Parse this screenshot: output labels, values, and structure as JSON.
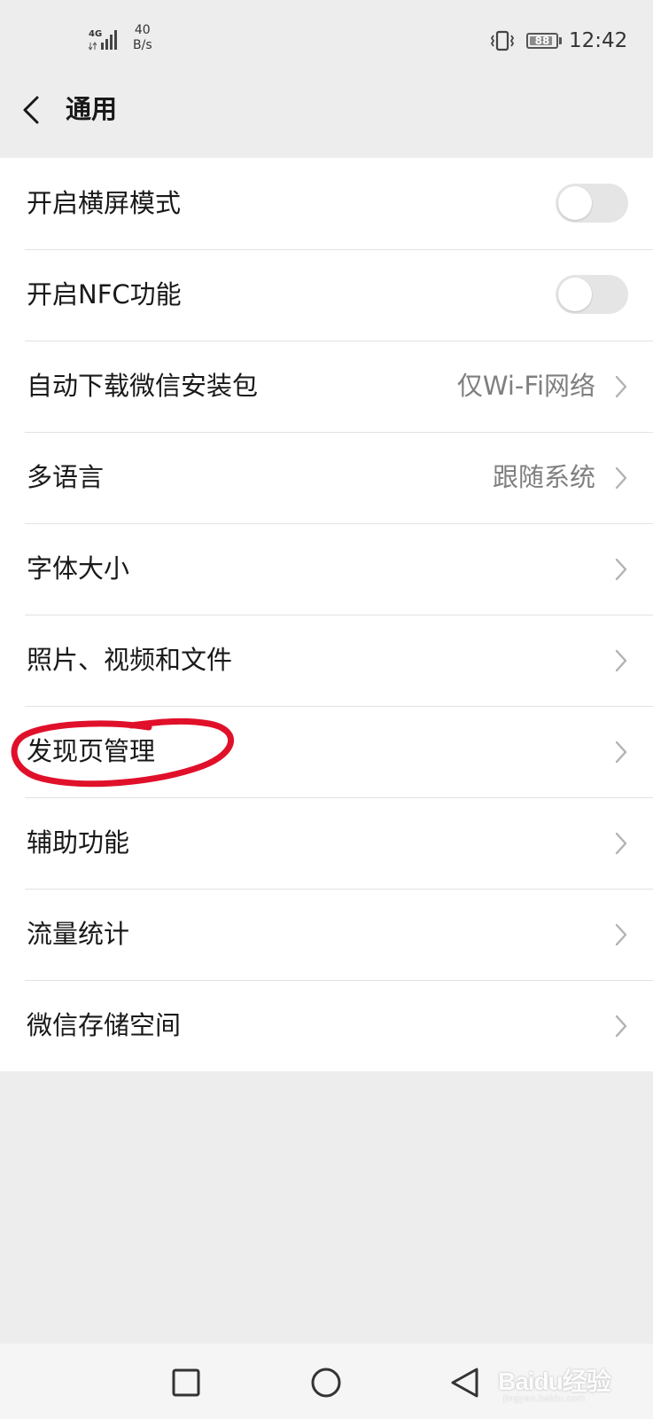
{
  "status_bar": {
    "network_type": "4G",
    "net_speed_value": "40",
    "net_speed_unit": "B/s",
    "battery_level": 88,
    "battery_text": "88",
    "time": "12:42"
  },
  "header": {
    "title": "通用",
    "back_icon": "chevron-left-icon"
  },
  "settings": {
    "items": [
      {
        "label": "开启横屏模式",
        "control": "toggle",
        "on": false
      },
      {
        "label": "开启NFC功能",
        "control": "toggle",
        "on": false
      },
      {
        "label": "自动下载微信安装包",
        "value": "仅Wi-Fi网络",
        "control": "chevron"
      },
      {
        "label": "多语言",
        "value": "跟随系统",
        "control": "chevron"
      },
      {
        "label": "字体大小",
        "control": "chevron"
      },
      {
        "label": "照片、视频和文件",
        "control": "chevron"
      },
      {
        "label": "发现页管理",
        "control": "chevron",
        "annotated": true
      },
      {
        "label": "辅助功能",
        "control": "chevron"
      },
      {
        "label": "流量统计",
        "control": "chevron"
      },
      {
        "label": "微信存储空间",
        "control": "chevron"
      }
    ]
  },
  "annotation": {
    "shape": "hand-drawn ellipse",
    "color": "#e0102a"
  },
  "nav_bar": {
    "buttons": [
      "recent-apps-icon",
      "home-icon",
      "back-triangle-icon"
    ]
  },
  "watermark": {
    "text": "Baidu经验",
    "sub": "jingyan.baidu.com"
  },
  "colors": {
    "background": "#ededed",
    "list_background": "#ffffff",
    "secondary_text": "#7f7f7f",
    "toggle_off": "#e5e5e5",
    "annotation_red": "#e0102a"
  }
}
